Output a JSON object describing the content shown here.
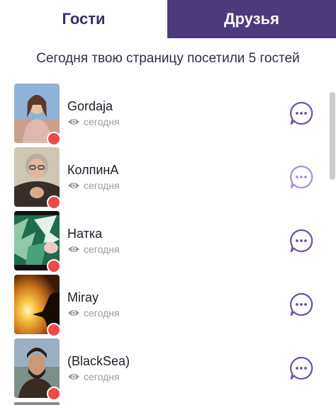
{
  "tabs": [
    {
      "label": "Гости",
      "active": true
    },
    {
      "label": "Друзья",
      "active": false
    }
  ],
  "headline": "Сегодня твою страницу посетили 5 гостей",
  "visitors": [
    {
      "name": "Gordaja",
      "seen": "сегодня",
      "online": true
    },
    {
      "name": "КолпинА",
      "seen": "сегодня",
      "online": true
    },
    {
      "name": "Натка",
      "seen": "сегодня",
      "online": true
    },
    {
      "name": "Miray",
      "seen": "сегодня",
      "online": true
    },
    {
      "name": "(BlackSea)",
      "seen": "сегодня",
      "online": true
    }
  ],
  "icons": {
    "seen": "eye-icon",
    "message": "chat-bubble-icon",
    "online": "online-dot"
  },
  "colors": {
    "accent": "#4c3a7d",
    "active_tab_text": "#3c2f6a",
    "online": "#f04848",
    "chat_icon": "#6a4fa3",
    "chat_icon_faded": "#a48fd0",
    "muted_text": "#9b9b9b"
  }
}
